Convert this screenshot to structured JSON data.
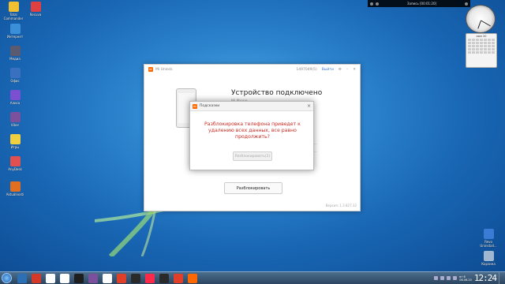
{
  "desktop_icons": [
    {
      "label": "Total Commander",
      "color": "#f0c030"
    },
    {
      "label": "Recuva",
      "color": "#e04040"
    },
    {
      "label": "Интернет",
      "color": "#3a8fd8"
    },
    {
      "label": "Медиа",
      "color": "#5a5a70"
    },
    {
      "label": "Офис",
      "color": "#3a70c0"
    },
    {
      "label": "Алиса",
      "color": "#7a50d0"
    },
    {
      "label": "Viber",
      "color": "#7b519d"
    },
    {
      "label": "Игры",
      "color": "#f0d040"
    },
    {
      "label": "AnyDesk",
      "color": "#e05050"
    },
    {
      "label": "Aktuálnosti",
      "color": "#e07020"
    }
  ],
  "recycle": {
    "label": "Корзина"
  },
  "recuva_right": {
    "label": "Revo Uninstall..."
  },
  "topbar": {
    "rec": "Запись [00:01:20]"
  },
  "calendar": {
    "header": "июн 20"
  },
  "window": {
    "title": "Mi Unlock",
    "account": "1497049(5)",
    "logout": "Выйти",
    "heading": "Устройство подключено",
    "model": "Mi Phone",
    "side1": "...",
    "side2": "...",
    "unlock_label": "Разблокировать",
    "version": "Версия: 1.3.827.32"
  },
  "dialog": {
    "title": "Подсказки",
    "message_line1": "Разблокировка телефона приведет к",
    "message_line2": "удалению всех данных, все равно",
    "message_line3": "продолжить?",
    "button": "Разблокировать(2)"
  },
  "taskbar": {
    "apps": [
      "#2d6fb5",
      "#d43a2a",
      "#ffffff",
      "#ffffff",
      "#1e1e1e",
      "#7b519d",
      "#ffffff",
      "#e0402a",
      "#2a2a2a",
      "#ff2a4a",
      "#2a2a2a",
      "#e0402a",
      "#ff6700"
    ],
    "clock": "12:24",
    "date_line1": "вт 6",
    "date_line2": "06.06.20"
  }
}
